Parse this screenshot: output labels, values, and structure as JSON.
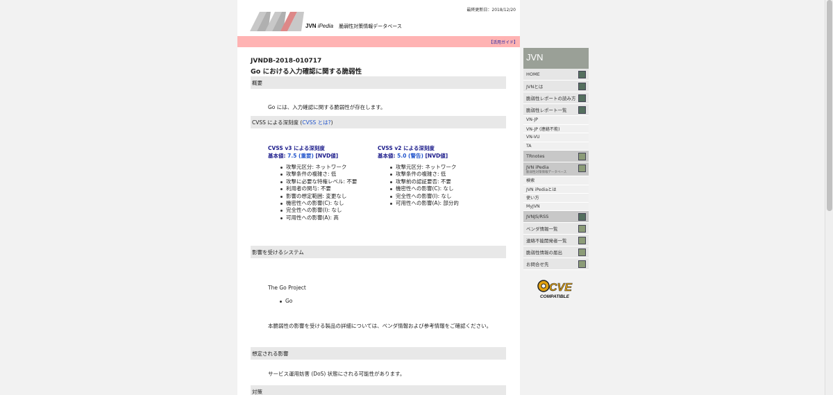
{
  "header": {
    "updated": "最終更新日：2018/12/20",
    "logo_main": "JVN",
    "logo_ip": "iPedia",
    "logo_sub": "脆弱性対策情報データベース",
    "guide": "【活用ガイド】"
  },
  "vuln": {
    "id": "JVNDB-2018-010717",
    "title": "Go における入力確認に関する脆弱性"
  },
  "sections": {
    "overview": "概要",
    "overview_text": "Go には、入力確認に関する脆弱性が存在します。",
    "cvss_prefix": "CVSS による深刻度 (",
    "cvss_link": "CVSS とは?",
    "cvss_suffix": ")",
    "affected": "影響を受けるシステム",
    "vendor": "The Go Project",
    "product": "Go",
    "affected_note": "本脆弱性の影響を受ける製品の詳細については、ベンダ情報および参考情報をご確認ください。",
    "impact": "想定される影響",
    "impact_text": "サービス運用妨害 (DoS) 状態にされる可能性があります。",
    "countermeasure": "対策"
  },
  "cvss3": {
    "title": "CVSS v3 による深刻度",
    "score_label": "基本値: ",
    "score_value": "7.5 (重要)",
    "score_suffix": " [NVD値]",
    "items": [
      "攻撃元区分: ネットワーク",
      "攻撃条件の複雑さ: 低",
      "攻撃に必要な特権レベル: 不要",
      "利用者の関与: 不要",
      "影響の想定範囲: 変更なし",
      "機密性への影響(C): なし",
      "完全性への影響(I): なし",
      "可用性への影響(A): 高"
    ]
  },
  "cvss2": {
    "title": "CVSS v2 による深刻度",
    "score_label": "基本値: ",
    "score_value": "5.0 (警告)",
    "score_suffix": " [NVD値]",
    "items": [
      "攻撃元区分: ネットワーク",
      "攻撃条件の複雑さ: 低",
      "攻撃前の認証要否: 不要",
      "機密性への影響(C): なし",
      "完全性への影響(I): なし",
      "可用性への影響(A): 部分的"
    ]
  },
  "sidebar": {
    "title": "JVN",
    "items": [
      {
        "label": "HOME"
      },
      {
        "label": "JVNとは"
      },
      {
        "label": "脆弱性レポートの読み方"
      },
      {
        "label": "脆弱性レポート一覧"
      },
      {
        "label": "VN-JP"
      },
      {
        "label": "VN-JP (連絡不能)"
      },
      {
        "label": "VN-VU"
      },
      {
        "label": "TA"
      },
      {
        "label": "TRnotes"
      },
      {
        "label": "JVN iPedia",
        "sub": "脆弱性対策情報データベース"
      },
      {
        "label": "検索"
      },
      {
        "label": "JVN iPediaとは"
      },
      {
        "label": "使い方"
      },
      {
        "label": "MyJVN"
      },
      {
        "label": "JVNJS/RSS"
      },
      {
        "label": "ベンダ情報一覧"
      },
      {
        "label": "連絡不能開発者一覧"
      },
      {
        "label": "脆弱性情報の届出"
      },
      {
        "label": "お問合せ先"
      }
    ],
    "cve_text": "CVE",
    "cve_compatible": "COMPATIBLE"
  }
}
